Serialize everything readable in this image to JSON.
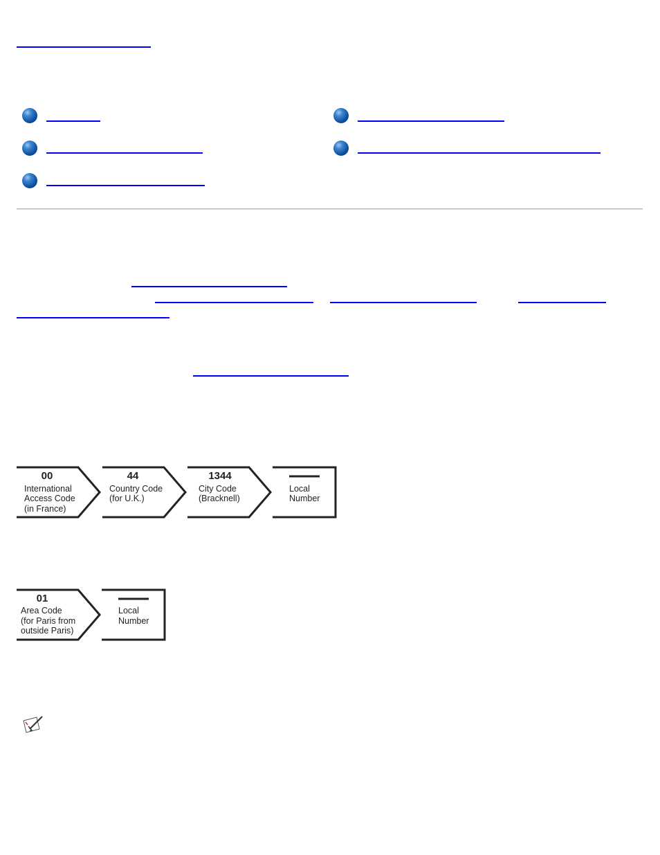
{
  "diagram1": {
    "boxes": [
      {
        "number": "00",
        "lines": [
          "International",
          "Access Code",
          "(in France)"
        ]
      },
      {
        "number": "44",
        "lines": [
          "Country Code",
          "(for U.K.)"
        ]
      },
      {
        "number": "1344",
        "lines": [
          "City Code",
          "(Bracknell)"
        ]
      },
      {
        "number": "",
        "lines": [
          "Local",
          "Number"
        ]
      }
    ]
  },
  "diagram2": {
    "boxes": [
      {
        "number": "01",
        "lines": [
          "Area Code",
          "(for Paris from",
          "outside Paris)"
        ]
      },
      {
        "number": "",
        "lines": [
          "Local",
          "Number"
        ]
      }
    ]
  },
  "icons": {
    "bullet": "blue-sphere-bullet",
    "note": "note-pencil-icon"
  },
  "colors": {
    "link": "#0000ff",
    "rule": "#b4b4b4"
  }
}
